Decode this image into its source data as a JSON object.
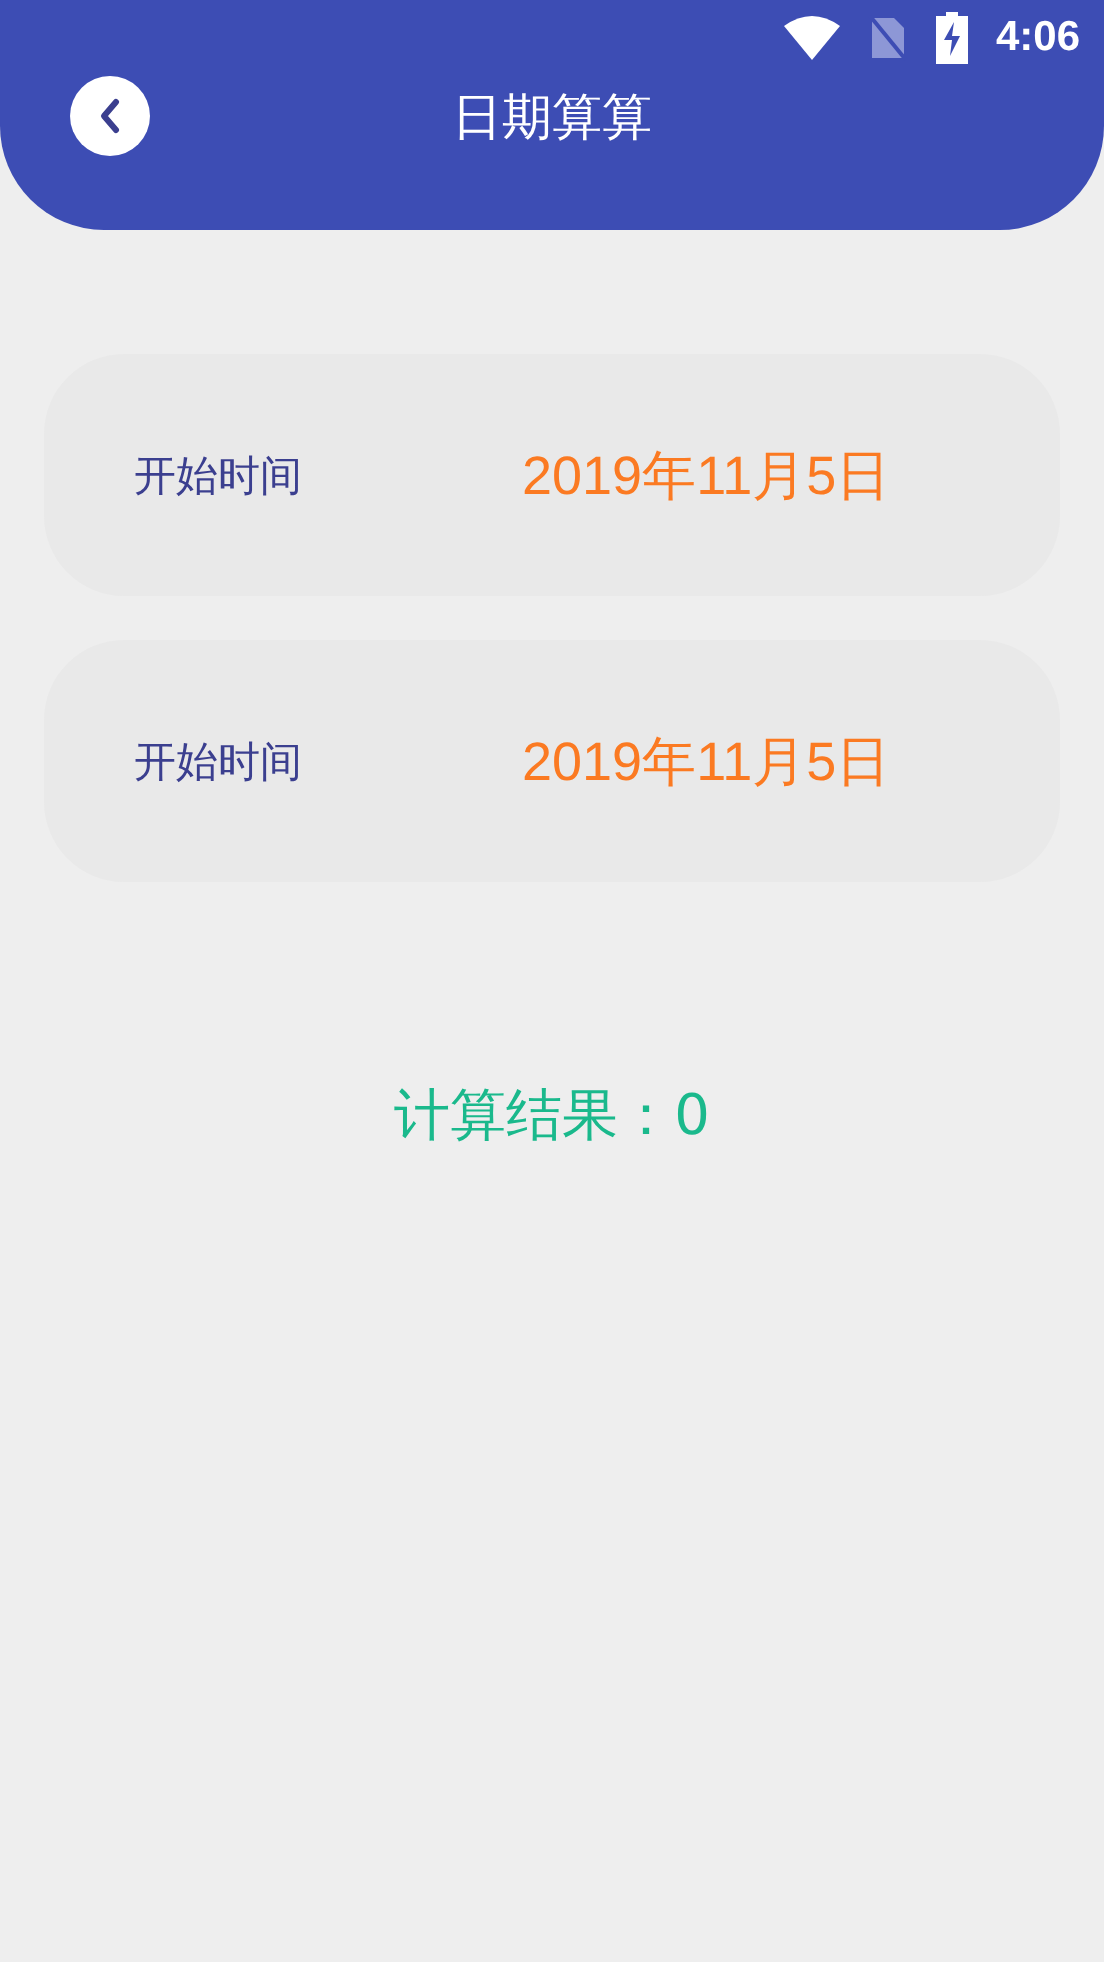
{
  "status_bar": {
    "time": "4:06"
  },
  "header": {
    "title": "日期算算"
  },
  "date_rows": [
    {
      "label": "开始时间",
      "value": "2019年11月5日"
    },
    {
      "label": "开始时间",
      "value": "2019年11月5日"
    }
  ],
  "result": "计算结果：0"
}
